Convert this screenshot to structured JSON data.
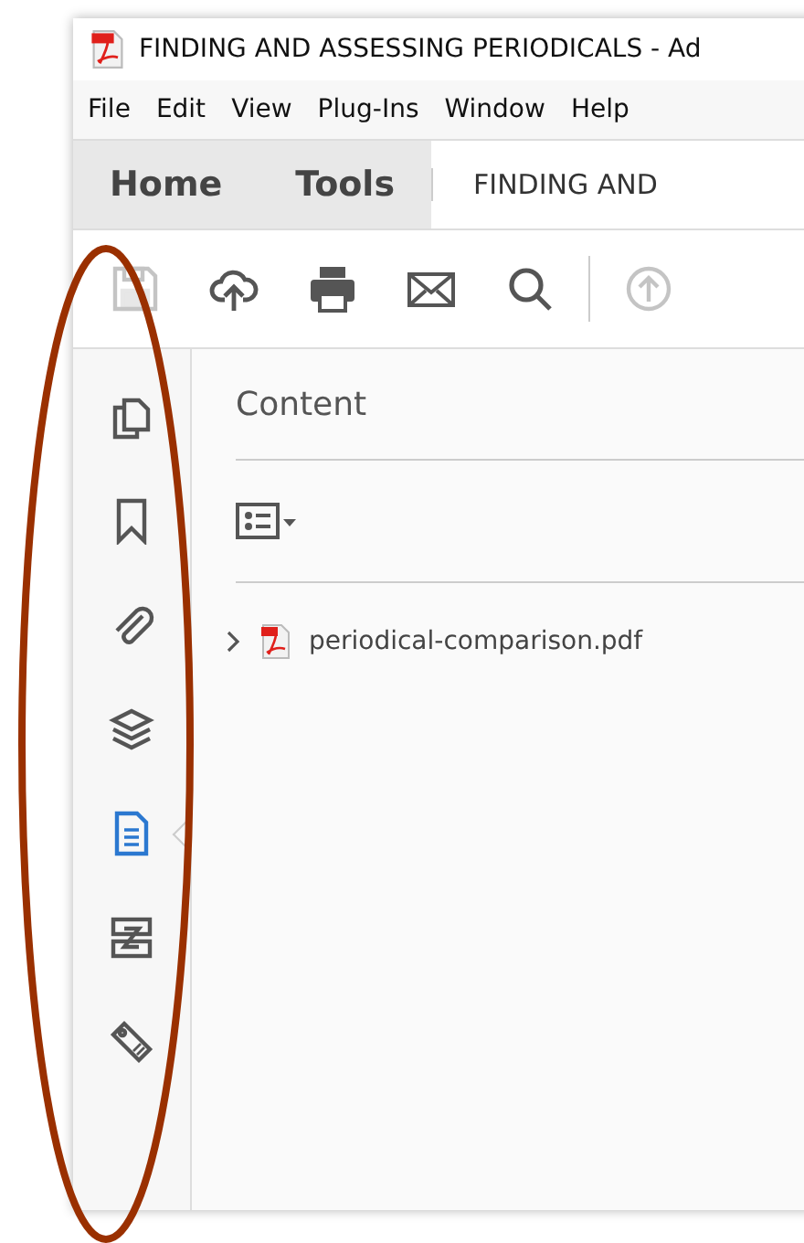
{
  "window": {
    "title": "FINDING AND ASSESSING PERIODICALS - Ad"
  },
  "menu": [
    "File",
    "Edit",
    "View",
    "Plug-Ins",
    "Window",
    "Help"
  ],
  "tabs": [
    {
      "label": "Home",
      "kind": "nav"
    },
    {
      "label": "Tools",
      "kind": "nav"
    },
    {
      "label": "FINDING AND",
      "kind": "document"
    }
  ],
  "toolbar": [
    {
      "kind": "save",
      "disabled": true
    },
    {
      "kind": "upload",
      "disabled": false
    },
    {
      "kind": "print",
      "disabled": false
    },
    {
      "kind": "mail",
      "disabled": false
    },
    {
      "kind": "search",
      "disabled": false
    },
    {
      "kind": "share",
      "disabled": true
    }
  ],
  "sidebar": {
    "items": [
      {
        "kind": "pages",
        "selected": false
      },
      {
        "kind": "bookmarks",
        "selected": false
      },
      {
        "kind": "attachments",
        "selected": false
      },
      {
        "kind": "layers",
        "selected": false
      },
      {
        "kind": "content",
        "selected": true
      },
      {
        "kind": "order",
        "selected": false
      },
      {
        "kind": "tags",
        "selected": false
      }
    ]
  },
  "panel": {
    "title": "Content",
    "tree": [
      {
        "label": "periodical-comparison.pdf",
        "expanded": false
      }
    ]
  }
}
